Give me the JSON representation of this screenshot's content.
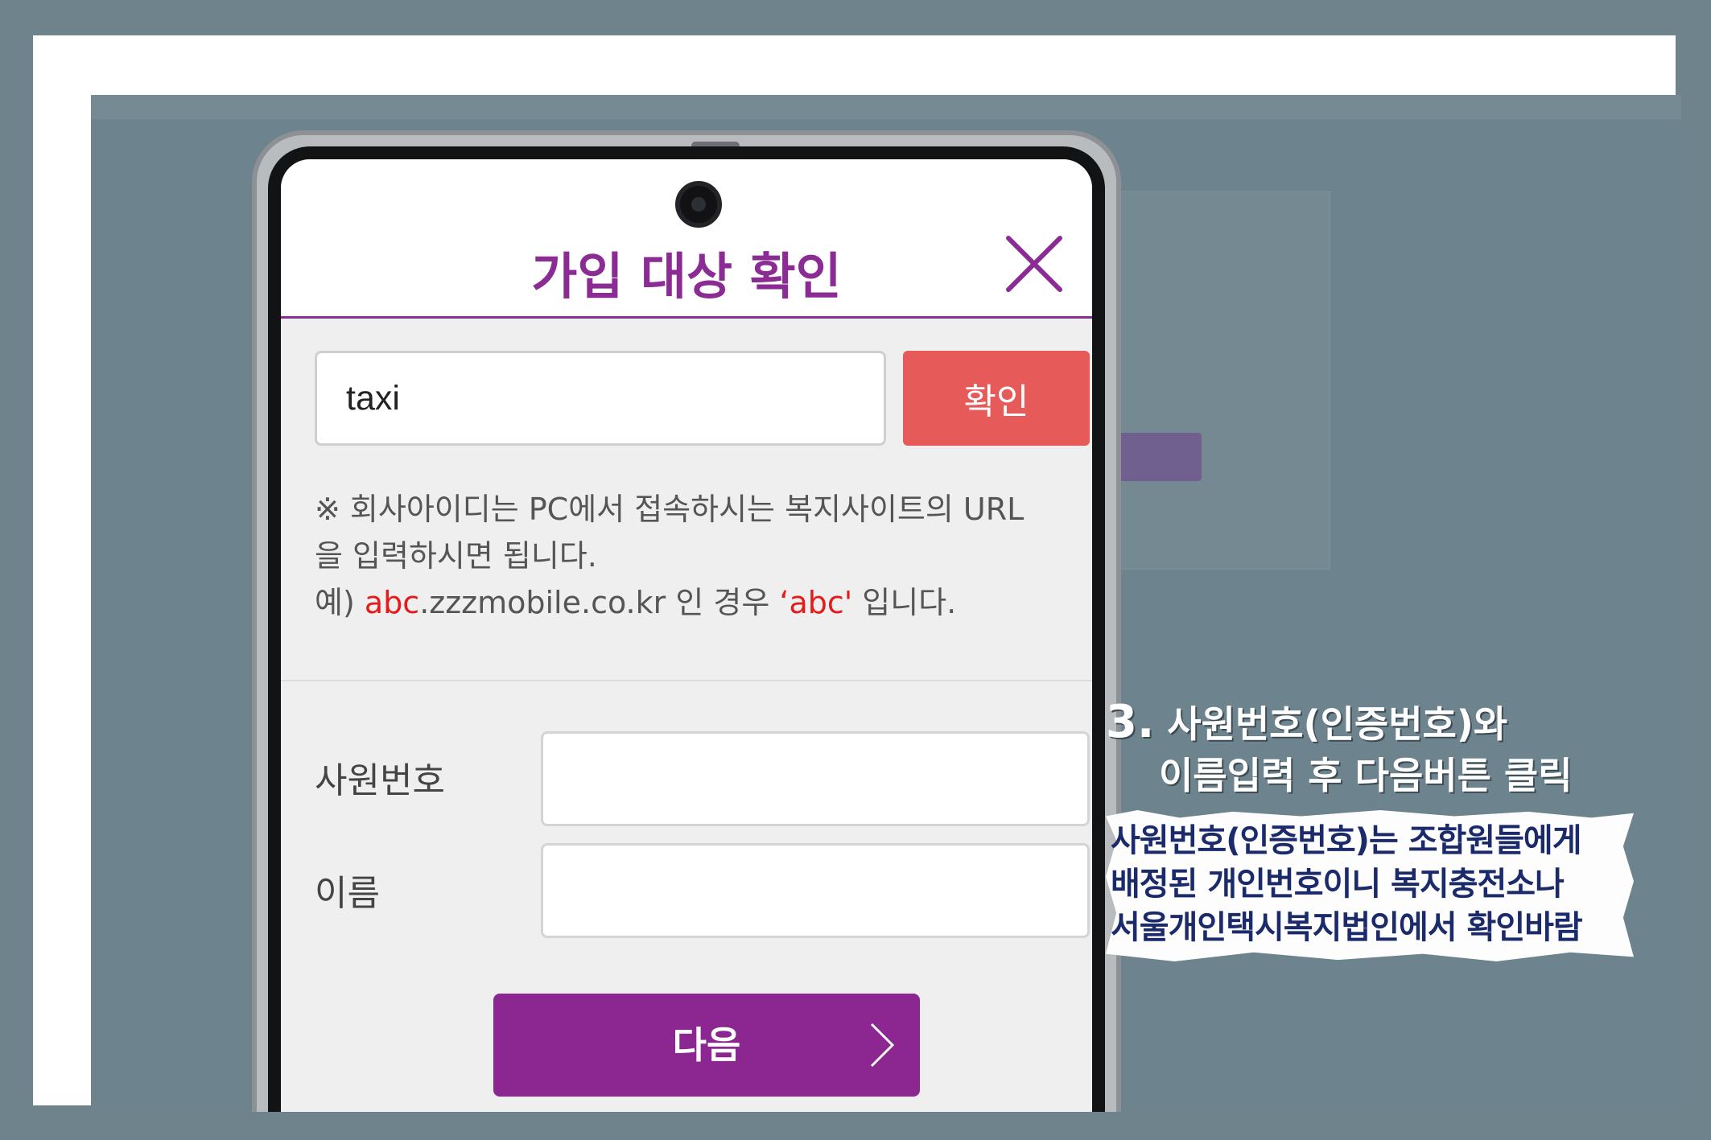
{
  "dialog": {
    "title": "가입 대상 확인",
    "company_field_value": "taxi",
    "confirm_label": "확인",
    "notice": {
      "line1": "※ 회사아이디는 PC에서 접속하시는 복지사이트의 URL",
      "line2": "을 입력하시면 됩니다.",
      "example_prefix": "예) ",
      "example_highlight": "abc",
      "example_domain": ".zzzmobile.co.kr 인 경우 ",
      "example_quote": "‘abc'",
      "example_suffix": " 입니다."
    },
    "employee_number_label": "사원번호",
    "name_label": "이름",
    "next_label": "다음"
  },
  "instruction": {
    "step_number": "3.",
    "line1": "사원번호(인증번호)와",
    "line2": "이름입력 후 다음버튼 클릭"
  },
  "note": {
    "line1": "사원번호(인증번호)는 조합원들에게",
    "line2": "배정된 개인번호이니 복지충전소나",
    "line3": "서울개인택시복지법인에서 확인바람"
  },
  "colors": {
    "accent_purple": "#8c2691",
    "confirm_red": "#e75a5a",
    "highlight_red": "#e61a1a",
    "note_text": "#1b2a6b"
  }
}
